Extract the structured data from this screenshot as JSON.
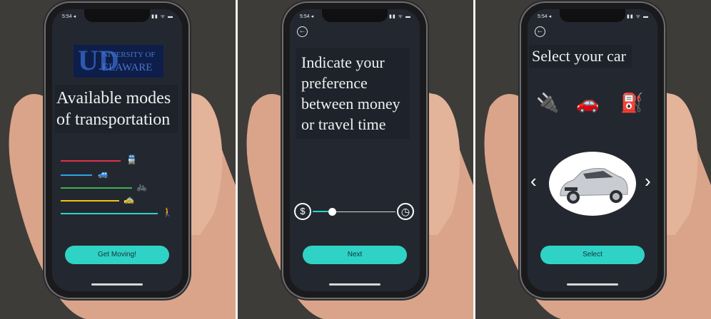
{
  "screens": [
    {
      "status_time": "5:54 ◂",
      "status_icons": "▮▮ ᯤ ▬",
      "logo": {
        "letter": "UD",
        "line1": "NIVERSITY OF",
        "line2": "ELAWARE"
      },
      "title": "Available modes of transportation",
      "modes": [
        {
          "icon": "train-icon",
          "glyph": "🚆",
          "color": "#e0304a"
        },
        {
          "icon": "car-icon",
          "glyph": "🚙",
          "color": "#2aa5e6"
        },
        {
          "icon": "bike-icon",
          "glyph": "🚲",
          "color": "#3db34a"
        },
        {
          "icon": "taxi-icon",
          "glyph": "🚕",
          "color": "#f2c40f"
        },
        {
          "icon": "walk-icon",
          "glyph": "🚶",
          "color": "#2fd3c5"
        }
      ],
      "button": "Get Moving!"
    },
    {
      "status_time": "5:54 ◂",
      "status_icons": "▮▮ ᯤ ▬",
      "title": "Indicate your preference between money or travel time",
      "slider": {
        "left_icon": "$",
        "right_icon": "◷",
        "value": 0.2
      },
      "button": "Next"
    },
    {
      "status_time": "5:54 ◂",
      "status_icons": "▮▮ ᯤ ▬",
      "title": "Select your car",
      "car_types": [
        {
          "icon": "electric-charger-icon",
          "glyph": "🔌"
        },
        {
          "icon": "plug-in-car-icon",
          "glyph": "🚗"
        },
        {
          "icon": "gas-pump-icon",
          "glyph": "⛽"
        }
      ],
      "prev": "‹",
      "next": "›",
      "button": "Select"
    }
  ]
}
